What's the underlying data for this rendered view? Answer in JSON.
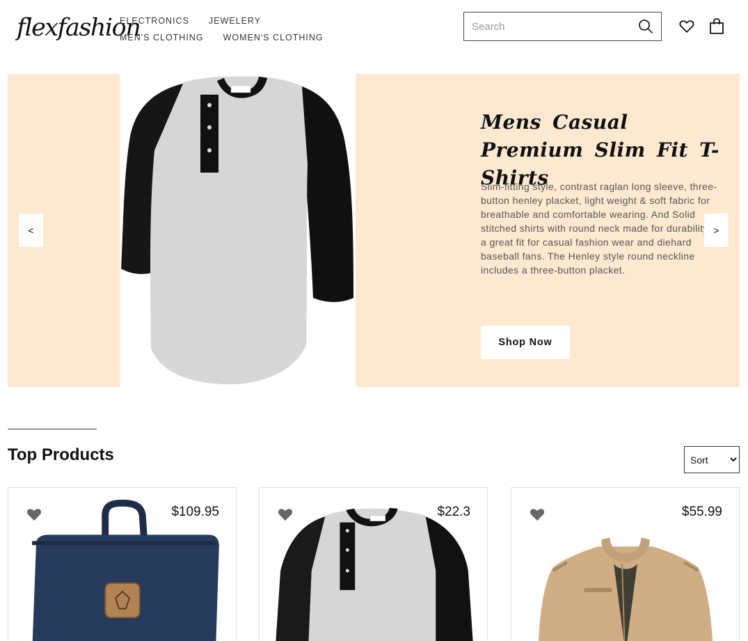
{
  "brand": {
    "logo": "flexfashion"
  },
  "nav": {
    "items": [
      "ELECTRONICS",
      "JEWELERY",
      "MEN'S CLOTHING",
      "WOMEN'S CLOTHING"
    ]
  },
  "search": {
    "placeholder": "Search",
    "icon": "search-icon"
  },
  "header_icons": [
    "heart-icon",
    "shopping-bag-icon"
  ],
  "hero": {
    "title": "Mens Casual Premium Slim Fit T-Shirts",
    "description": "Slim-fitting style, contrast raglan long sleeve, three-button henley placket, light weight & soft fabric for breathable and comfortable wearing. And Solid stitched shirts with round neck made for durability and a great fit for casual fashion wear and diehard baseball fans. The Henley style round neckline includes a three-button placket.",
    "cta": "Shop Now",
    "prev": "<",
    "next": ">",
    "background": "#fde8d0"
  },
  "products_section": {
    "title": "Top Products",
    "sort_label": "Sort",
    "items": [
      {
        "price": "$109.95",
        "image": "backpack"
      },
      {
        "price": "$22.3",
        "image": "raglan-tshirt"
      },
      {
        "price": "$55.99",
        "image": "jacket"
      }
    ]
  }
}
